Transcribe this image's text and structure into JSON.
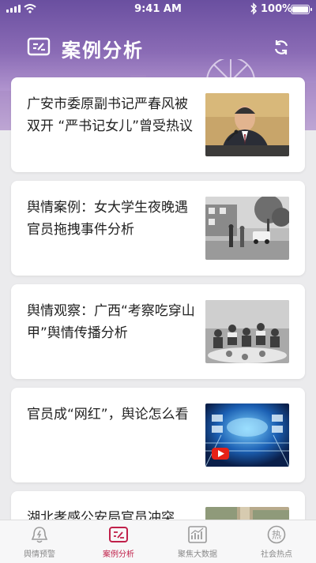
{
  "status_bar": {
    "time": "9:41 AM",
    "battery": "100%"
  },
  "header": {
    "title": "案例分析",
    "logo_icon": "case-analysis-icon",
    "refresh_icon": "refresh-icon"
  },
  "cards": [
    {
      "headline": "广安市委原副书记严春风被双开 “严书记女儿”曾受热议",
      "thumb": "official-speaking-photo"
    },
    {
      "headline": "舆情案例：女大学生夜晚遇官员拖拽事件分析",
      "thumb": "street-scene-photo"
    },
    {
      "headline": "舆情观察：广西“考察吃穿山甲”舆情传播分析",
      "thumb": "group-dinner-photo"
    },
    {
      "headline": "官员成“网红”，舆论怎么看",
      "thumb": "tech-video-photo"
    },
    {
      "headline": "湖北孝感公安局官员冲突",
      "thumb": "aerial-city-photo"
    }
  ],
  "tabs": [
    {
      "label": "舆情预警",
      "icon": "bell-alert-icon",
      "active": false
    },
    {
      "label": "案例分析",
      "icon": "case-analysis-icon",
      "active": true
    },
    {
      "label": "聚焦大数据",
      "icon": "chart-icon",
      "active": false
    },
    {
      "label": "社会热点",
      "icon": "hot-topic-icon",
      "active": false
    }
  ],
  "colors": {
    "accent": "#c0204a",
    "hero_top": "#6a4fa0",
    "hero_bottom": "#d9c7e6"
  }
}
